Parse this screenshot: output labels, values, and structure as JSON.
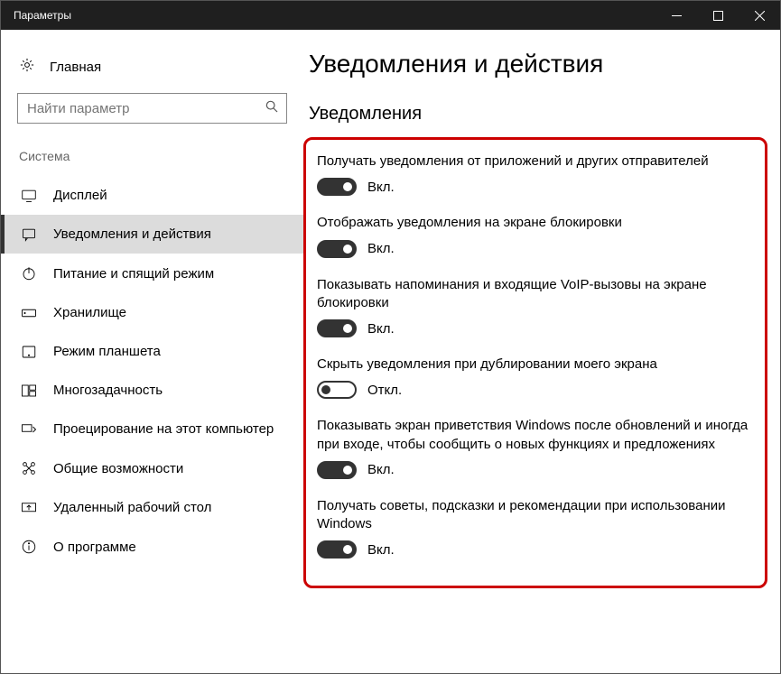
{
  "window": {
    "title": "Параметры"
  },
  "sidebar": {
    "home": "Главная",
    "search_placeholder": "Найти параметр",
    "section": "Система",
    "items": [
      {
        "label": "Дисплей"
      },
      {
        "label": "Уведомления и действия"
      },
      {
        "label": "Питание и спящий режим"
      },
      {
        "label": "Хранилище"
      },
      {
        "label": "Режим планшета"
      },
      {
        "label": "Многозадачность"
      },
      {
        "label": "Проецирование на этот компьютер"
      },
      {
        "label": "Общие возможности"
      },
      {
        "label": "Удаленный рабочий стол"
      },
      {
        "label": "О программе"
      }
    ]
  },
  "main": {
    "title": "Уведомления и действия",
    "section": "Уведомления",
    "settings": [
      {
        "desc": "Получать уведомления от приложений и других отправителей",
        "on": true,
        "state": "Вкл."
      },
      {
        "desc": "Отображать уведомления на экране блокировки",
        "on": true,
        "state": "Вкл."
      },
      {
        "desc": "Показывать напоминания и входящие VoIP-вызовы на экране блокировки",
        "on": true,
        "state": "Вкл."
      },
      {
        "desc": "Скрыть уведомления при дублировании моего экрана",
        "on": false,
        "state": "Откл."
      },
      {
        "desc": "Показывать экран приветствия Windows после обновлений и иногда при входе, чтобы сообщить о новых функциях и предложениях",
        "on": true,
        "state": "Вкл."
      },
      {
        "desc": "Получать советы, подсказки и рекомендации при использовании Windows",
        "on": true,
        "state": "Вкл."
      }
    ]
  }
}
